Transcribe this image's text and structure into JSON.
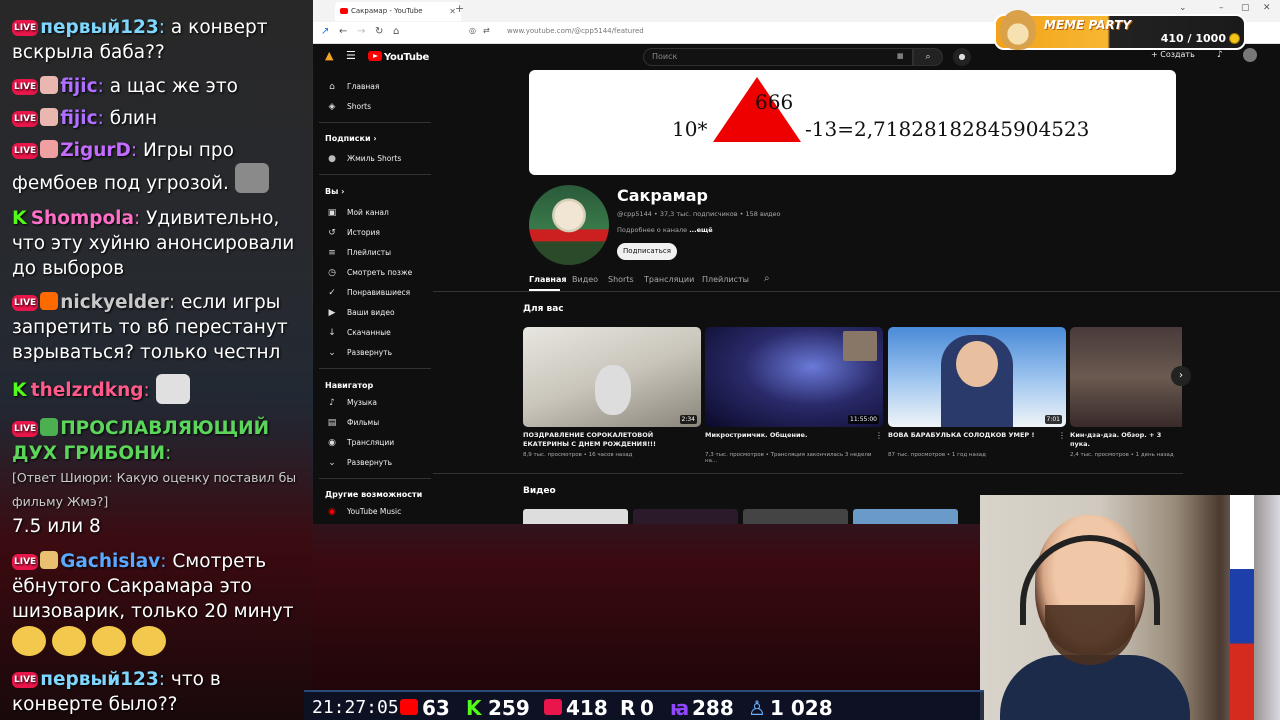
{
  "chat": {
    "messages": [
      {
        "badge": "live",
        "nick": "первый123",
        "nick_color": "#7fd7ff",
        "text": "а конверт вскрыла баба??"
      },
      {
        "badge": "live",
        "emote": true,
        "nick": "fijic",
        "nick_color": "#b070ff",
        "text": "а щас же это"
      },
      {
        "badge": "live",
        "emote": true,
        "nick": "fijic",
        "nick_color": "#b070ff",
        "text": "блин"
      },
      {
        "badge": "live",
        "emote": true,
        "nick": "ZigurD",
        "nick_color": "#c36cff",
        "text": "Игры про фембоев под угрозой."
      },
      {
        "badge": "k",
        "nick": "Shompola",
        "nick_color": "#ff6ec7",
        "text": "Удивительно, что эту хуйню анонсировали до выборов"
      },
      {
        "badge": "live",
        "emote": true,
        "nick": "nickyelder",
        "nick_color": "#c8c8c8",
        "text": "если игры запретить то вб перестанут взрываться? только честнл"
      },
      {
        "badge": "k",
        "nick": "thelzrdkng",
        "nick_color": "#ff5a8a",
        "text": ""
      },
      {
        "badge": "live",
        "emote": true,
        "nick": "ПРОСЛАВЛЯЮЩИЙ ДУХ ГРИБОНИ",
        "nick_color": "#5bd65b",
        "text": ""
      },
      {
        "reply": "[Ответ Шиюри: Какую оценку поставил бы фильму Жмэ?]",
        "text2": "7.5 или 8"
      },
      {
        "badge": "live",
        "emote": true,
        "nick": "Gachislav",
        "nick_color": "#5aa8ff",
        "text": "Смотреть ёбнутого Сакрамара это шизоварик, только 20 минут"
      },
      {
        "badge": "live",
        "nick": "первый123",
        "nick_color": "#7fd7ff",
        "text": "что в конверте было??"
      }
    ]
  },
  "browser": {
    "tab_title": "Сакрамар - YouTube",
    "url": "www.youtube.com/@cpp5144/featured"
  },
  "youtube": {
    "logo": "YouTube",
    "search_placeholder": "Поиск",
    "create": "Создать",
    "sidebar": {
      "main": [
        "Главная",
        "Shorts"
      ],
      "subs_head": "Подписки",
      "subs": [
        "Жмиль Shorts"
      ],
      "you_head": "Вы",
      "you": [
        "Мой канал",
        "История",
        "Плейлисты",
        "Смотреть позже",
        "Понравившиеся",
        "Ваши видео",
        "Скачанные",
        "Развернуть"
      ],
      "nav_head": "Навигатор",
      "nav": [
        "Музыка",
        "Фильмы",
        "Трансляции",
        "Развернуть"
      ],
      "more_head": "Другие возможности",
      "more": [
        "YouTube Music"
      ]
    },
    "banner": {
      "n666": "666",
      "n10": "10*",
      "expr": "-13=2,71828182845904523"
    },
    "channel": {
      "name": "Сакрамар",
      "meta": "@cpp5144 • 37,3 тыс. подписчиков • 158 видео",
      "about": "Подробнее о канале",
      "about_more": "...ещё",
      "subscribe": "Подписаться"
    },
    "tabs": [
      "Главная",
      "Видео",
      "Shorts",
      "Трансляции",
      "Плейлисты"
    ],
    "section_for_you": "Для вас",
    "section_videos": "Видео",
    "videos": [
      {
        "title": "ПОЗДРАВЛЕНИЕ СОРОКАЛЕТОВОЙ ЕКАТЕРИНЫ С ДНЕМ РОЖДЕНИЯ!!!",
        "meta": "8,9 тыс. просмотров • 16 часов назад",
        "duration": "2:34"
      },
      {
        "title": "Микростримчик. Общение.",
        "meta": "7,3 тыс. просмотров • Трансляция закончилась 3 недели на...",
        "duration": "11:55:00"
      },
      {
        "title": "ВОВА БАРАБУЛЬКА СОЛОДКОВ УМЕР !",
        "meta": "87 тыс. просмотров • 1 год назад",
        "duration": "7:01"
      },
      {
        "title": "Кин-дза-дза. Обзор. + 3 пука.",
        "meta": "2,4 тыс. просмотров • 1 день назад",
        "duration": ""
      }
    ]
  },
  "meme": {
    "title": "MEME PARTY",
    "count": "410 / 1000"
  },
  "stats": {
    "time": "21:27:05",
    "youtube": "63",
    "kick": "259",
    "live": "418",
    "r": "0",
    "twitch": "288",
    "viewers": "1 028"
  },
  "colors": {
    "youtube_red": "#ff0000",
    "kick_green": "#53fc18",
    "live_pink": "#e8164a"
  }
}
